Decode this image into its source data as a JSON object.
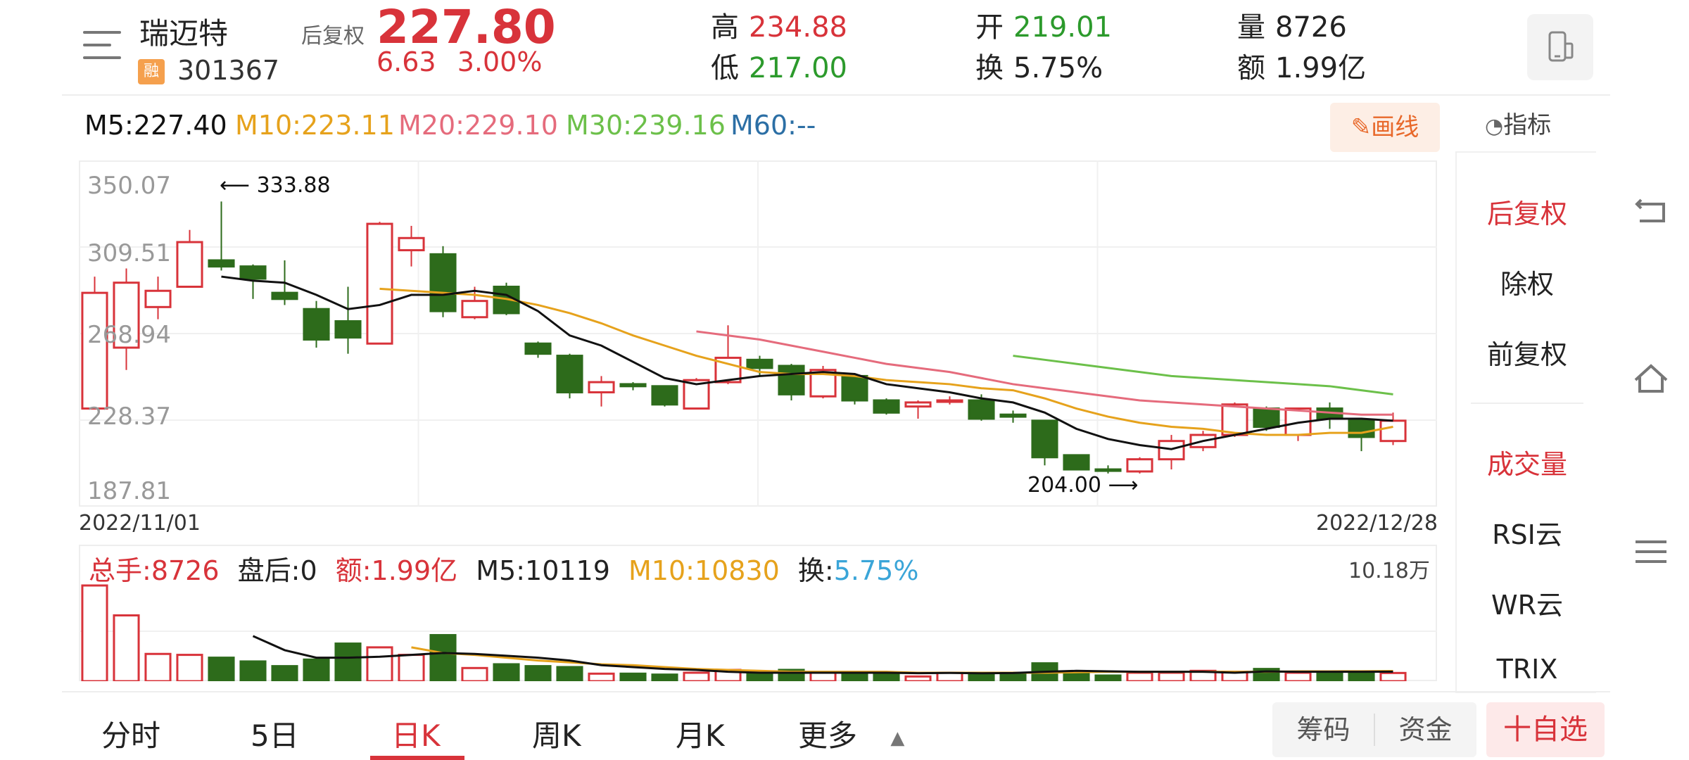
{
  "header": {
    "stock_name": "瑞迈特",
    "rong_badge": "融",
    "stock_code": "301367",
    "adj_label": "后复权",
    "price": "227.80",
    "change": "6.63",
    "change_pct": "3.00%",
    "high_label": "高",
    "high": "234.88",
    "low_label": "低",
    "low": "217.00",
    "open_label": "开",
    "open": "219.01",
    "turnover_label": "换",
    "turnover": "5.75%",
    "volume_label": "量",
    "volume": "8726",
    "amount_label": "额",
    "amount": "1.99亿"
  },
  "ma_legend": {
    "m5": "M5:227.40",
    "m10": "M10:223.11",
    "m20": "M20:229.10",
    "m30": "M30:239.16",
    "m60": "M60:--"
  },
  "toolbar": {
    "draw_label": "画线",
    "indicator_label": "指标"
  },
  "side_panel": {
    "items": [
      "后复权",
      "除权",
      "前复权",
      "成交量",
      "RSI云",
      "WR云",
      "TRIX"
    ]
  },
  "kline": {
    "y_labels": [
      "350.07",
      "309.51",
      "268.94",
      "228.37",
      "187.81"
    ],
    "start_date": "2022/11/01",
    "end_date": "2022/12/28",
    "max_annotation": "333.88",
    "min_annotation": "204.00"
  },
  "volume_panel": {
    "total_label": "总手:",
    "total": "8726",
    "after_label": "盘后:",
    "after": "0",
    "amount_label": "额:",
    "amount": "1.99亿",
    "m5": "M5:10119",
    "m10": "M10:10830",
    "turnover_label": "换:",
    "turnover": "5.75%",
    "max_label": "10.18万"
  },
  "bottom_tabs": [
    "分时",
    "5日",
    "日K",
    "周K",
    "月K",
    "更多"
  ],
  "bottom_buttons": {
    "chips": "筹码",
    "funds": "资金",
    "add_watch": "十自选"
  },
  "colors": {
    "up": "#d8333a",
    "down": "#2d6b1b",
    "ma5": "#111111",
    "ma10": "#e6a21c",
    "ma20": "#e56b7c",
    "ma30": "#6cc04a",
    "ma60": "#2c6fa5"
  },
  "chart_data": {
    "type": "candlestick",
    "ylim": [
      187.81,
      350.07
    ],
    "candles": [
      {
        "o": 232,
        "c": 289,
        "h": 297,
        "l": 232,
        "up": true
      },
      {
        "o": 262,
        "c": 294,
        "h": 301,
        "l": 251,
        "up": true
      },
      {
        "o": 282,
        "c": 290,
        "h": 297,
        "l": 276,
        "up": true
      },
      {
        "o": 292,
        "c": 314,
        "h": 320,
        "l": 292,
        "up": true
      },
      {
        "o": 305,
        "c": 302,
        "h": 334,
        "l": 300,
        "up": false
      },
      {
        "o": 302,
        "c": 296,
        "h": 303,
        "l": 286,
        "up": false
      },
      {
        "o": 289,
        "c": 286,
        "h": 305,
        "l": 283,
        "up": false
      },
      {
        "o": 281,
        "c": 266,
        "h": 285,
        "l": 262,
        "up": false
      },
      {
        "o": 275,
        "c": 267,
        "h": 292,
        "l": 259,
        "up": false
      },
      {
        "o": 264,
        "c": 323,
        "h": 324,
        "l": 264,
        "up": true
      },
      {
        "o": 310,
        "c": 316,
        "h": 322,
        "l": 302,
        "up": true
      },
      {
        "o": 308,
        "c": 280,
        "h": 312,
        "l": 277,
        "up": false
      },
      {
        "o": 277,
        "c": 285,
        "h": 292,
        "l": 276,
        "up": true
      },
      {
        "o": 292,
        "c": 279,
        "h": 294,
        "l": 278,
        "up": false
      },
      {
        "o": 264,
        "c": 259,
        "h": 265,
        "l": 257,
        "up": false
      },
      {
        "o": 258,
        "c": 240,
        "h": 259,
        "l": 237,
        "up": false
      },
      {
        "o": 240,
        "c": 245,
        "h": 248,
        "l": 233,
        "up": true
      },
      {
        "o": 244,
        "c": 243,
        "h": 245,
        "l": 241,
        "up": false
      },
      {
        "o": 243,
        "c": 234,
        "h": 243,
        "l": 233,
        "up": false
      },
      {
        "o": 232,
        "c": 246,
        "h": 247,
        "l": 232,
        "up": true
      },
      {
        "o": 245,
        "c": 257,
        "h": 273,
        "l": 244,
        "up": true
      },
      {
        "o": 256,
        "c": 252,
        "h": 258,
        "l": 248,
        "up": false
      },
      {
        "o": 253,
        "c": 239,
        "h": 254,
        "l": 236,
        "up": false
      },
      {
        "o": 238,
        "c": 251,
        "h": 253,
        "l": 237,
        "up": true
      },
      {
        "o": 248,
        "c": 236,
        "h": 249,
        "l": 234,
        "up": false
      },
      {
        "o": 236,
        "c": 230,
        "h": 237,
        "l": 229,
        "up": false
      },
      {
        "o": 233,
        "c": 235,
        "h": 236,
        "l": 227,
        "up": true
      },
      {
        "o": 236,
        "c": 236,
        "h": 238,
        "l": 234,
        "up": true
      },
      {
        "o": 236,
        "c": 227,
        "h": 239,
        "l": 226,
        "up": false
      },
      {
        "o": 229,
        "c": 228,
        "h": 231,
        "l": 225,
        "up": false
      },
      {
        "o": 226,
        "c": 208,
        "h": 226,
        "l": 204,
        "up": false
      },
      {
        "o": 209,
        "c": 202,
        "h": 209,
        "l": 202,
        "up": false
      },
      {
        "o": 202,
        "c": 202,
        "h": 204,
        "l": 200,
        "up": false
      },
      {
        "o": 201,
        "c": 207,
        "h": 208,
        "l": 200,
        "up": true
      },
      {
        "o": 207,
        "c": 216,
        "h": 219,
        "l": 202,
        "up": true
      },
      {
        "o": 213,
        "c": 219,
        "h": 221,
        "l": 211,
        "up": true
      },
      {
        "o": 219,
        "c": 234,
        "h": 235,
        "l": 218,
        "up": true
      },
      {
        "o": 232,
        "c": 223,
        "h": 233,
        "l": 221,
        "up": false
      },
      {
        "o": 219,
        "c": 232,
        "h": 232,
        "l": 216,
        "up": true
      },
      {
        "o": 232,
        "c": 227,
        "h": 235,
        "l": 222,
        "up": false
      },
      {
        "o": 226,
        "c": 218,
        "h": 227,
        "l": 211,
        "up": false
      },
      {
        "o": 216,
        "c": 226,
        "h": 230,
        "l": 214,
        "up": true
      }
    ],
    "ma5": [
      null,
      null,
      null,
      null,
      297,
      295,
      294,
      288,
      281,
      283,
      288,
      288,
      290,
      288,
      280,
      268,
      263,
      255,
      247,
      244,
      246,
      248,
      249,
      250,
      249,
      244,
      242,
      240,
      237,
      235,
      230,
      222,
      217,
      214,
      212,
      216,
      219,
      222,
      225,
      227,
      227,
      226
    ],
    "ma10": [
      null,
      null,
      null,
      null,
      null,
      null,
      null,
      null,
      null,
      291,
      290,
      289,
      288,
      286,
      283,
      279,
      274,
      268,
      263,
      258,
      254,
      250,
      249,
      249,
      248,
      246,
      245,
      244,
      242,
      241,
      237,
      232,
      228,
      225,
      223,
      222,
      220,
      219,
      219,
      220,
      220,
      223
    ],
    "ma20": [
      null,
      null,
      null,
      null,
      null,
      null,
      null,
      null,
      null,
      null,
      null,
      null,
      null,
      null,
      null,
      null,
      null,
      null,
      null,
      270,
      268,
      266,
      263,
      260,
      257,
      254,
      252,
      250,
      247,
      244,
      242,
      240,
      238,
      236,
      235,
      234,
      233,
      232,
      231,
      230,
      229,
      229
    ],
    "ma30": [
      null,
      null,
      null,
      null,
      null,
      null,
      null,
      null,
      null,
      null,
      null,
      null,
      null,
      null,
      null,
      null,
      null,
      null,
      null,
      null,
      null,
      null,
      null,
      null,
      null,
      null,
      null,
      null,
      null,
      258,
      256,
      254,
      252,
      250,
      248,
      247,
      246,
      245,
      244,
      243,
      241,
      239
    ],
    "volume": {
      "ymax": 101800,
      "values": [
        101800,
        70000,
        29000,
        28000,
        25000,
        21000,
        16000,
        23000,
        40000,
        36000,
        28000,
        49000,
        14000,
        18000,
        16000,
        15000,
        8000,
        8000,
        7000,
        9000,
        12000,
        9000,
        12000,
        9000,
        8000,
        8000,
        5000,
        9000,
        9000,
        9000,
        19000,
        10000,
        6000,
        9000,
        9000,
        11000,
        10000,
        13000,
        9000,
        8000,
        9000,
        8726
      ],
      "ma5": [
        null,
        null,
        null,
        null,
        null,
        48000,
        33000,
        25000,
        25000,
        26000,
        28000,
        30000,
        29000,
        27000,
        25000,
        22000,
        17000,
        15000,
        13000,
        12000,
        10000,
        9000,
        9000,
        9000,
        9000,
        9000,
        8500,
        8800,
        8400,
        8700,
        10000,
        11000,
        10500,
        10000,
        10000,
        10000,
        9000,
        10400,
        10000,
        10000,
        10000,
        10119
      ],
      "ma10": [
        null,
        null,
        null,
        null,
        null,
        null,
        null,
        null,
        null,
        null,
        36000,
        30000,
        28000,
        25000,
        22000,
        20000,
        18000,
        17000,
        15000,
        13000,
        12000,
        11000,
        10000,
        10000,
        10000,
        10000,
        9000,
        9000,
        9000,
        9000,
        9000,
        9500,
        10000,
        10000,
        10000,
        10000,
        10000,
        10000,
        10500,
        10500,
        10600,
        10830
      ]
    }
  }
}
